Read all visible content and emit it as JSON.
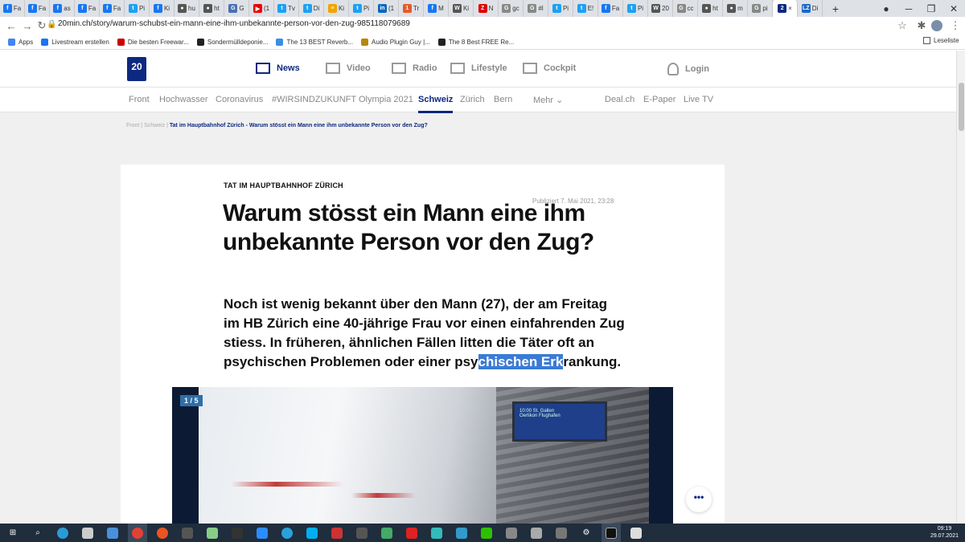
{
  "browser": {
    "tabs": [
      {
        "label": "Fa",
        "fav": "f",
        "color": "#1877f2"
      },
      {
        "label": "Fa",
        "fav": "f",
        "color": "#1877f2"
      },
      {
        "label": "as",
        "fav": "f",
        "color": "#1877f2"
      },
      {
        "label": "Fa",
        "fav": "f",
        "color": "#1877f2"
      },
      {
        "label": "Fa",
        "fav": "f",
        "color": "#1877f2"
      },
      {
        "label": "Pi",
        "fav": "t",
        "color": "#1da1f2"
      },
      {
        "label": "Ki",
        "fav": "f",
        "color": "#1877f2"
      },
      {
        "label": "hu",
        "fav": "●",
        "color": "#555"
      },
      {
        "label": "ht",
        "fav": "●",
        "color": "#555"
      },
      {
        "label": "G",
        "fav": "G",
        "color": "#4a6fb5"
      },
      {
        "label": "(1",
        "fav": "▶",
        "color": "#e00"
      },
      {
        "label": "Tv",
        "fav": "t",
        "color": "#1da1f2"
      },
      {
        "label": "Di",
        "fav": "t",
        "color": "#1da1f2"
      },
      {
        "label": "Ki",
        "fav": "≡",
        "color": "#f0a500"
      },
      {
        "label": "Pi",
        "fav": "t",
        "color": "#1da1f2"
      },
      {
        "label": "(1",
        "fav": "in",
        "color": "#0a66c2"
      },
      {
        "label": "Tr",
        "fav": "1",
        "color": "#e35b2a"
      },
      {
        "label": "M",
        "fav": "f",
        "color": "#1877f2"
      },
      {
        "label": "Ki",
        "fav": "W",
        "color": "#555"
      },
      {
        "label": "N",
        "fav": "Z",
        "color": "#d00"
      },
      {
        "label": "gc",
        "fav": "G",
        "color": "#888"
      },
      {
        "label": "#l",
        "fav": "G",
        "color": "#888"
      },
      {
        "label": "Pi",
        "fav": "t",
        "color": "#1da1f2"
      },
      {
        "label": "E!",
        "fav": "t",
        "color": "#1da1f2"
      },
      {
        "label": "Fa",
        "fav": "f",
        "color": "#1877f2"
      },
      {
        "label": "Pi",
        "fav": "t",
        "color": "#1da1f2"
      },
      {
        "label": "20",
        "fav": "W",
        "color": "#555"
      },
      {
        "label": "cc",
        "fav": "G",
        "color": "#888"
      },
      {
        "label": "ht",
        "fav": "●",
        "color": "#555"
      },
      {
        "label": "m",
        "fav": "●",
        "color": "#555"
      },
      {
        "label": "pi",
        "fav": "G",
        "color": "#888"
      },
      {
        "label": "×",
        "fav": "2",
        "color": "#0d2880",
        "active": true
      },
      {
        "label": "Di",
        "fav": "LZ",
        "color": "#1a66c8"
      }
    ],
    "new_tab": "+",
    "url": "20min.ch/story/warum-schubst-ein-mann-eine-ihm-unbekannte-person-vor-den-zug-985118079689",
    "bookmarks": [
      {
        "label": "Apps",
        "color": "#4285f4"
      },
      {
        "label": "Livestream erstellen",
        "color": "#1877f2"
      },
      {
        "label": "Die besten Freewar...",
        "color": "#c00"
      },
      {
        "label": "Sondermülldeponie...",
        "color": "#222"
      },
      {
        "label": "The 13 BEST Reverb...",
        "color": "#3a8ee6"
      },
      {
        "label": "Audio Plugin Guy |...",
        "color": "#b8860b"
      },
      {
        "label": "The 8 Best FREE Re...",
        "color": "#222"
      }
    ],
    "reading_list": "Leseliste"
  },
  "site": {
    "logo": "20",
    "top_nav": [
      {
        "label": "News",
        "active": true
      },
      {
        "label": "Video"
      },
      {
        "label": "Radio"
      },
      {
        "label": "Lifestyle"
      },
      {
        "label": "Cockpit"
      }
    ],
    "login": "Login",
    "sections": [
      {
        "label": "Front"
      },
      {
        "label": "Hochwasser"
      },
      {
        "label": "Coronavirus"
      },
      {
        "label": "#WIRSINDZUKUNFT"
      },
      {
        "label": "Olympia 2021"
      },
      {
        "label": "Schweiz",
        "active": true
      },
      {
        "label": "Zürich"
      },
      {
        "label": "Bern"
      },
      {
        "label": "Mehr ⌄"
      },
      {
        "label": "Deal.ch"
      },
      {
        "label": "E-Paper"
      },
      {
        "label": "Live TV"
      }
    ],
    "breadcrumb": {
      "front": "Front",
      "sep": "|",
      "schweiz": "Schweiz",
      "current": "Tat im Hauptbahnhof Zürich - Warum stösst ein Mann eine ihm unbekannte Person vor den Zug?"
    }
  },
  "article": {
    "kicker": "TAT IM HAUPTBAHNHOF ZÜRICH",
    "published": "Publiziert 7. Mai 2021, 23:28",
    "headline": "Warum stösst ein Mann eine ihm unbekannte Person vor den Zug?",
    "lead_before": "Noch ist wenig bekannt über den Mann (27), der am Freitag im HB Zürich eine 40-jährige Frau vor einen einfahrenden Zug stiess. In früheren, ähnlichen Fällen litten die Täter oft an psychischen Problemen oder einer psy",
    "lead_highlight": "chischen Erk",
    "lead_after": "rankung.",
    "gallery_counter": "1 / 5",
    "board_text": "10:00 St. Gallen\nOerlikon Flughafen"
  },
  "taskbar": {
    "time": "09:19",
    "date": "29.07.2021"
  }
}
